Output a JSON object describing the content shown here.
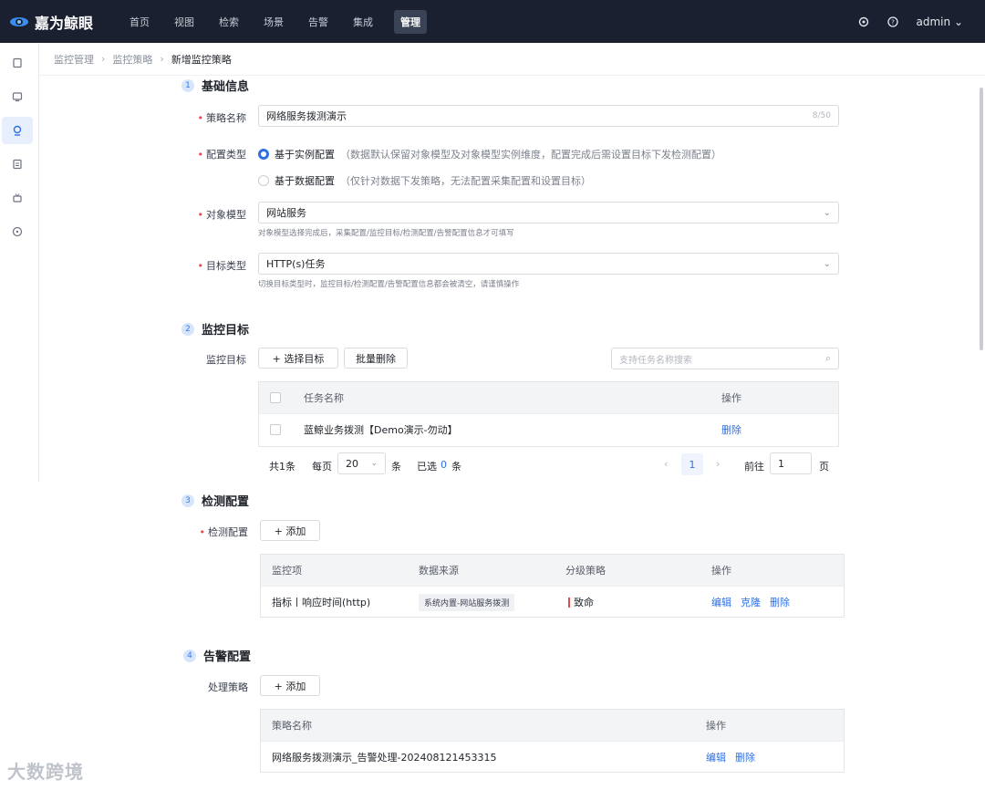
{
  "app": {
    "brand": "嘉为鲸眼"
  },
  "nav": {
    "items": [
      "首页",
      "视图",
      "检索",
      "场景",
      "告警",
      "集成",
      "管理"
    ],
    "active_index": 6
  },
  "top_right": {
    "user": "admin"
  },
  "breadcrumb": [
    "监控管理",
    "监控策略",
    "新增监控策略"
  ],
  "section1": {
    "num": "1",
    "title": "基础信息",
    "name_label": "策略名称",
    "name_value": "网络服务拨测演示",
    "name_count": "8/50",
    "config_label": "配置类型",
    "opt1_title": "基于实例配置",
    "opt1_desc": "（数据默认保留对象模型及对象模型实例维度，配置完成后需设置目标下发检测配置）",
    "opt2_title": "基于数据配置",
    "opt2_desc": "（仅针对数据下发策略，无法配置采集配置和设置目标）",
    "model_label": "对象模型",
    "model_value": "网站服务",
    "model_hint": "对象模型选择完成后，采集配置/监控目标/检测配置/告警配置信息才可填写",
    "target_label": "目标类型",
    "target_value": "HTTP(s)任务",
    "target_hint": "切换目标类型时，监控目标/检测配置/告警配置信息都会被清空，请谨慎操作"
  },
  "section2": {
    "num": "2",
    "title": "监控目标",
    "label": "监控目标",
    "select_btn": "+ 选择目标",
    "batch_delete_btn": "批量删除",
    "search_placeholder": "支持任务名称搜索",
    "columns": [
      "任务名称",
      "操作"
    ],
    "rows": [
      {
        "name": "蓝鲸业务拨测【Demo演示-勿动】",
        "action": "删除"
      }
    ],
    "pager": {
      "total": "共1条",
      "per_page_label": "每页",
      "per_page": "20",
      "unit": "条",
      "selected_label": "已选",
      "selected": "0",
      "selected_unit": "条",
      "current_page": "1",
      "goto_label": "前往",
      "goto_value": "1",
      "page_unit": "页"
    }
  },
  "section3": {
    "num": "3",
    "title": "检测配置",
    "label": "检测配置",
    "add_btn": "+ 添加",
    "columns": [
      "监控项",
      "数据来源",
      "分级策略",
      "操作"
    ],
    "rows": [
      {
        "item": "指标丨响应时间(http)",
        "source": "系统内置-网站服务拨测",
        "level": "致命",
        "actions": [
          "编辑",
          "克隆",
          "删除"
        ]
      }
    ]
  },
  "section4": {
    "num": "4",
    "title": "告警配置",
    "label": "处理策略",
    "add_btn": "+ 添加",
    "columns": [
      "策略名称",
      "操作"
    ],
    "rows": [
      {
        "name": "网络服务拨测演示_告警处理-202408121453315",
        "actions": [
          "编辑",
          "删除"
        ]
      }
    ]
  },
  "watermark": "大数跨境",
  "colors": {
    "topbar": "#1b2030",
    "accent": "#2f6fe4",
    "danger": "#e5484d"
  }
}
